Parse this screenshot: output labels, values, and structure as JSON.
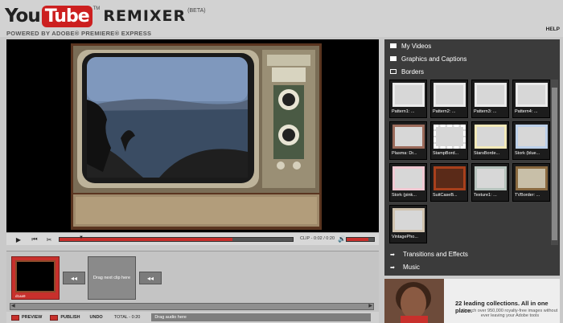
{
  "header": {
    "logo_you": "You",
    "logo_tube": "Tube",
    "logo_tm": "TM",
    "logo_remixer": "REMIXER",
    "logo_beta": "(BETA)",
    "powered_by": "POWERED BY ADOBE® PREMIERE® EXPRESS",
    "help": "HELP"
  },
  "player": {
    "clip_time": "CLIP - 0:02 / 0:20",
    "playhead_progress": 0.74,
    "volume_level": 0.8,
    "icons": [
      "play-icon",
      "step-back-icon",
      "scissors-icon",
      "volume-icon"
    ]
  },
  "timeline": {
    "clip_label": "d1aa9",
    "drag_clip": "Drag next clip here",
    "bottom": {
      "preview": "PREVIEW",
      "publish": "PUBLISH",
      "undo": "UNDO",
      "total": "TOTAL - 0:20",
      "drag_audio": "Drag audio here"
    }
  },
  "panel": {
    "categories": [
      {
        "label": "My Videos",
        "icon": "video-icon"
      },
      {
        "label": "Graphics and Captions",
        "icon": "graphics-icon"
      },
      {
        "label": "Borders",
        "icon": "folder-icon"
      }
    ],
    "borders": [
      {
        "label": "Pattern1: ..."
      },
      {
        "label": "Pattern2: ..."
      },
      {
        "label": "Pattern3: ..."
      },
      {
        "label": "Pattern4: ..."
      },
      {
        "label": "Plasma: Dr..."
      },
      {
        "label": "StampBord..."
      },
      {
        "label": "StarsBorde..."
      },
      {
        "label": "Stork (blue..."
      },
      {
        "label": "Stork (pink..."
      },
      {
        "label": "SuitCaseB..."
      },
      {
        "label": "Texture1: ..."
      },
      {
        "label": "TVBorder: ..."
      },
      {
        "label": "VintagePho..."
      }
    ],
    "sections": [
      {
        "label": "Transitions and Effects",
        "icon": "arrow-icon"
      },
      {
        "label": "Music",
        "icon": "arrow-icon"
      }
    ]
  },
  "ad": {
    "headline": "22 leading collections. All in one place.",
    "body": "Search over 950,000 royalty-free images without ever leaving your Adobe tools"
  },
  "colors": {
    "accent_red": "#c8302c",
    "panel_dark": "#3b3b3b",
    "stage_black": "#000000"
  }
}
